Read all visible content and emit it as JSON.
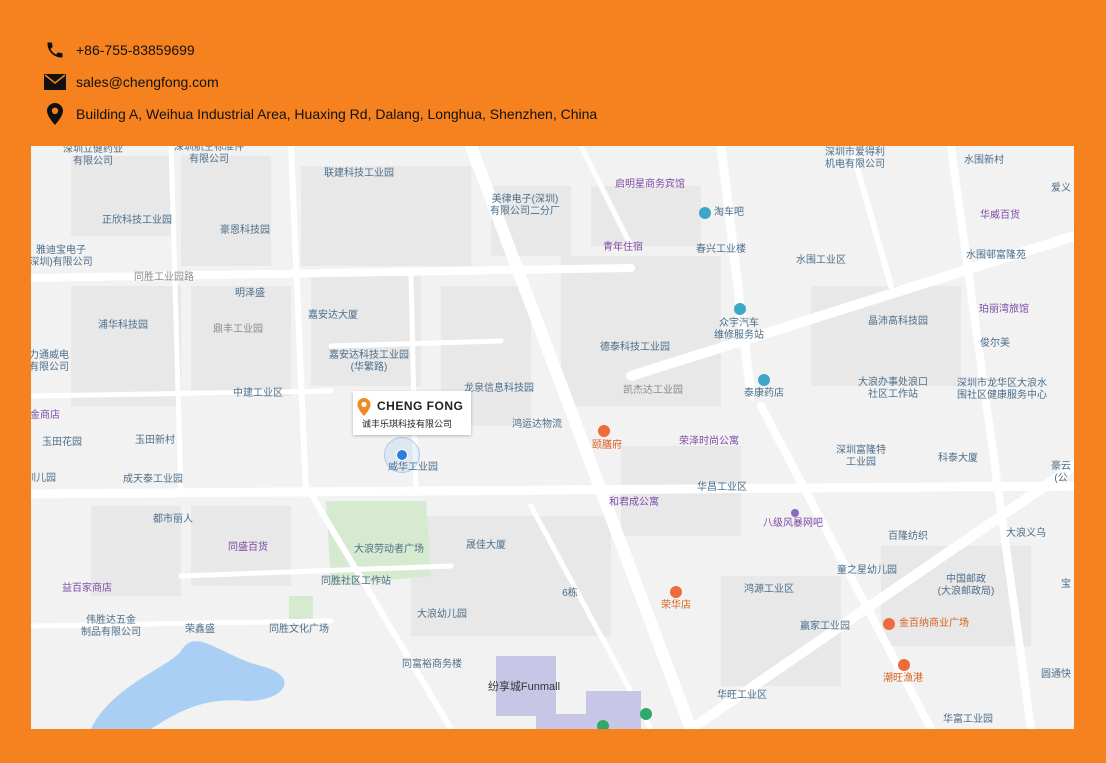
{
  "contact": {
    "phone": "+86-755-83859699",
    "email": "sales@chengfong.com",
    "address": "Building A, Weihua Industrial Area, Huaxing Rd, Dalang, Longhua, Shenzhen, China",
    "icons": [
      "phone-icon",
      "mail-icon",
      "location-pin-icon"
    ]
  },
  "colors": {
    "background": "#f5821f",
    "map_base": "#f2f2f2",
    "road": "#ffffff",
    "park": "#d6ead0",
    "water": "#a9cff5",
    "block": "#e8e8e8",
    "label_blue": "#4c6e8a",
    "label_purple": "#7d4aa6",
    "label_orange": "#d8611e"
  },
  "marker": {
    "brand": "CHENG FONG",
    "company": "诚丰乐琪科技有限公司"
  },
  "map_labels": [
    {
      "text": "深圳立健药业\n有限公司",
      "style": "b"
    },
    {
      "text": "深圳航空标准件\n有限公司",
      "style": "b"
    },
    {
      "text": "联建科技工业园",
      "style": "b"
    },
    {
      "text": "美律电子(深圳)\n有限公司二分厂",
      "style": "b"
    },
    {
      "text": "启明星商务宾馆",
      "style": "p"
    },
    {
      "text": "深圳市爱得利\n机电有限公司",
      "style": "b"
    },
    {
      "text": "水围新村",
      "style": "b"
    },
    {
      "text": "爱义",
      "style": "b"
    },
    {
      "text": "正欣科技工业园",
      "style": "b"
    },
    {
      "text": "豪恩科技园",
      "style": "b"
    },
    {
      "text": "淘车吧",
      "style": "b"
    },
    {
      "text": "华威百货",
      "style": "p"
    },
    {
      "text": "雅迪宝电子\n深圳)有限公司",
      "style": "b"
    },
    {
      "text": "青年住宿",
      "style": "p"
    },
    {
      "text": "春兴工业楼",
      "style": "b"
    },
    {
      "text": "水围工业区",
      "style": "b"
    },
    {
      "text": "水围邨富隆苑",
      "style": "b"
    },
    {
      "text": "同胜工业园路",
      "style": "g"
    },
    {
      "text": "明泽盛",
      "style": "b"
    },
    {
      "text": "浦华科技园",
      "style": "b"
    },
    {
      "text": "鼎丰工业园",
      "style": "g"
    },
    {
      "text": "嘉安达大厦",
      "style": "b"
    },
    {
      "text": "众宇汽车\n维修服务站",
      "style": "b"
    },
    {
      "text": "晶沛高科技园",
      "style": "b"
    },
    {
      "text": "珀丽湾旅馆",
      "style": "p"
    },
    {
      "text": "力通威电\n有限公司",
      "style": "b"
    },
    {
      "text": "嘉安达科技工业园\n(华繁路)",
      "style": "b"
    },
    {
      "text": "德泰科技工业园",
      "style": "b"
    },
    {
      "text": "俊尔美",
      "style": "b"
    },
    {
      "text": "中建工业区",
      "style": "b"
    },
    {
      "text": "龙泉信息科技园",
      "style": "b"
    },
    {
      "text": "凯杰达工业园",
      "style": "g"
    },
    {
      "text": "泰康药店",
      "style": "b"
    },
    {
      "text": "大浪办事处浪口\n社区工作站",
      "style": "b"
    },
    {
      "text": "深圳市龙华区大浪水\n围社区健康服务中心",
      "style": "b"
    },
    {
      "text": "金商店",
      "style": "p"
    },
    {
      "text": "鸿运达物流",
      "style": "b"
    },
    {
      "text": "玉田花园",
      "style": "b"
    },
    {
      "text": "玉田新村",
      "style": "b"
    },
    {
      "text": "颐膳府",
      "style": "o"
    },
    {
      "text": "荣泽时尚公寓",
      "style": "p"
    },
    {
      "text": "深圳富隆特\n工业园",
      "style": "b"
    },
    {
      "text": "科泰大厦",
      "style": "b"
    },
    {
      "text": "豪云\n(公",
      "style": "b"
    },
    {
      "text": "训儿园",
      "style": "b"
    },
    {
      "text": "成天泰工业园",
      "style": "b"
    },
    {
      "text": "威华工业园",
      "style": "b"
    },
    {
      "text": "华昌工业区",
      "style": "b"
    },
    {
      "text": "和君成公寓",
      "style": "p"
    },
    {
      "text": "都市丽人",
      "style": "b"
    },
    {
      "text": "八级风暴网吧",
      "style": "p"
    },
    {
      "text": "百隆纺织",
      "style": "b"
    },
    {
      "text": "大浪义乌",
      "style": "b"
    },
    {
      "text": "同盛百货",
      "style": "p"
    },
    {
      "text": "大浪劳动者广场",
      "style": "b"
    },
    {
      "text": "晟佳大厦",
      "style": "b"
    },
    {
      "text": "童之星幼儿园",
      "style": "b"
    },
    {
      "text": "中国邮政\n(大浪邮政局)",
      "style": "b"
    },
    {
      "text": "宝",
      "style": "b"
    },
    {
      "text": "益百家商店",
      "style": "p"
    },
    {
      "text": "同胜社区工作站",
      "style": "b"
    },
    {
      "text": "6栋",
      "style": "b"
    },
    {
      "text": "鸿源工业区",
      "style": "b"
    },
    {
      "text": "荣华店",
      "style": "o"
    },
    {
      "text": "伟胜达五金\n制品有限公司",
      "style": "b"
    },
    {
      "text": "荣鑫盛",
      "style": "b"
    },
    {
      "text": "同胜文化广场",
      "style": "b"
    },
    {
      "text": "大浪幼儿园",
      "style": "b"
    },
    {
      "text": "赢家工业园",
      "style": "b"
    },
    {
      "text": "金百纳商业广场",
      "style": "o"
    },
    {
      "text": "同富裕商务楼",
      "style": "b"
    },
    {
      "text": "潮旺渔港",
      "style": "o"
    },
    {
      "text": "纷享城Funmall",
      "style": "d"
    },
    {
      "text": "华旺工业区",
      "style": "b"
    },
    {
      "text": "圆通快",
      "style": "b"
    },
    {
      "text": "华富工业园",
      "style": "b"
    }
  ]
}
